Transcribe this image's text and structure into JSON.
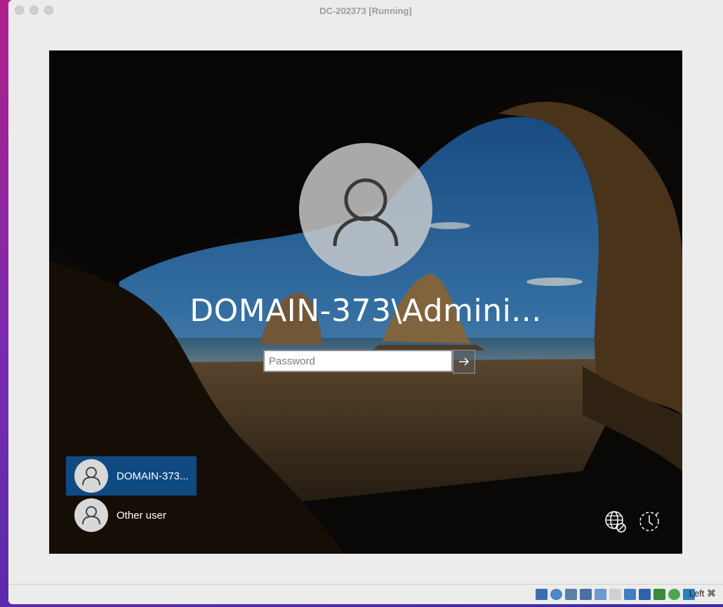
{
  "window": {
    "title": "DC-202373 [Running]"
  },
  "login": {
    "username": "DOMAIN-373\\Admini...",
    "password_placeholder": "Password"
  },
  "users": [
    {
      "label": "DOMAIN-373...",
      "selected": true
    },
    {
      "label": "Other user",
      "selected": false
    }
  ],
  "corner_icons": [
    "network-icon",
    "power-icon"
  ],
  "statusbar": {
    "icons": [
      "hard-disk-icon",
      "optical-drive-icon",
      "audio-icon",
      "network-adapter-icon",
      "usb-icon",
      "shared-folder-icon",
      "display-icon",
      "recording-icon",
      "cpu-icon",
      "mouse-integration-icon",
      "globe-icon",
      "download-icon"
    ],
    "host_key": "Left ⌘"
  },
  "colors": {
    "selected_user_bg": "#0f4a83",
    "screen_bg": "#0b0a08"
  }
}
